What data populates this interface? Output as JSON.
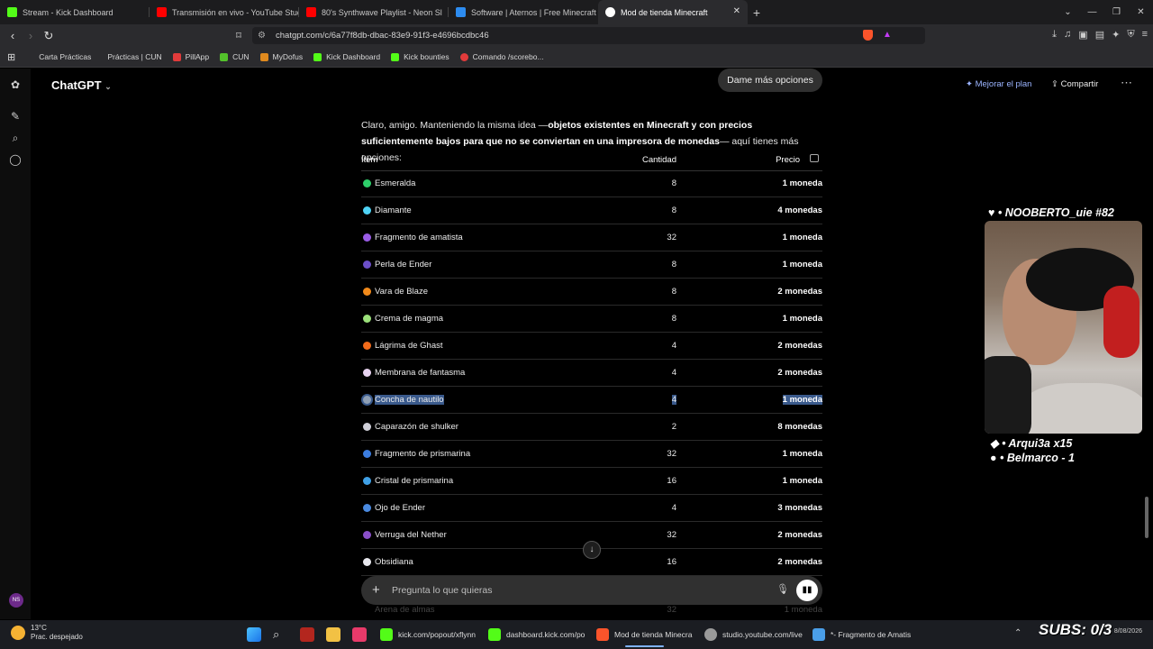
{
  "browser": {
    "tabs": [
      {
        "label": "Stream - Kick Dashboard",
        "color": "#53fc18"
      },
      {
        "label": "Transmisión en vivo - YouTube Studio",
        "color": "#ff0000"
      },
      {
        "label": "80's Synthwave Playlist - Neon Sl",
        "color": "#ff0000"
      },
      {
        "label": "Software | Aternos | Free Minecraft S",
        "color": "#2d8cf0"
      },
      {
        "label": "Mod de tienda Minecraft",
        "color": "#ffffff"
      }
    ],
    "new_tab": "+",
    "url": "chatgpt.com/c/6a77f8db-dbac-83e9-91f3-e4696bcdbc46",
    "bookmarks": [
      {
        "label": "Carta Prácticas",
        "color": "#777777"
      },
      {
        "label": "Prácticas | CUN",
        "color": "#777777"
      },
      {
        "label": "PillApp",
        "color": "#e23b3b"
      },
      {
        "label": "CUN",
        "color": "#53c22b"
      },
      {
        "label": "MyDofus",
        "color": "#e08a1e"
      },
      {
        "label": "Kick Dashboard",
        "color": "#53fc18"
      },
      {
        "label": "Kick bounties",
        "color": "#53fc18"
      },
      {
        "label": "Comando /scorebo...",
        "color": "#e23b3b"
      }
    ]
  },
  "chatgpt": {
    "title": "ChatGPT",
    "pill": "Dame más opciones",
    "upgrade": "Mejorar el plan",
    "share": "Compartir",
    "intro_start": "Claro, amigo. Manteniendo la misma idea —",
    "intro_bold": "objetos existentes en Minecraft y con precios suficientemente bajos para que no se conviertan en una impresora de monedas",
    "intro_end": "— aquí tienes más opciones:",
    "table": {
      "headers": {
        "item": "Ítem",
        "qty": "Cantidad",
        "price": "Precio"
      },
      "rows": [
        {
          "name": "Esmeralda",
          "qty": "8",
          "price": "1 moneda",
          "icon": "#2ecf6a"
        },
        {
          "name": "Diamante",
          "qty": "8",
          "price": "4 monedas",
          "icon": "#4fd3f5"
        },
        {
          "name": "Fragmento de amatista",
          "qty": "32",
          "price": "1 moneda",
          "icon": "#9a5ce6"
        },
        {
          "name": "Perla de Ender",
          "qty": "8",
          "price": "1 moneda",
          "icon": "#6c4fc9"
        },
        {
          "name": "Vara de Blaze",
          "qty": "8",
          "price": "2 monedas",
          "icon": "#f28a1a"
        },
        {
          "name": "Crema de magma",
          "qty": "8",
          "price": "1 moneda",
          "icon": "#9be07a"
        },
        {
          "name": "Lágrima de Ghast",
          "qty": "4",
          "price": "2 monedas",
          "icon": "#f26b1a"
        },
        {
          "name": "Membrana de fantasma",
          "qty": "4",
          "price": "2 monedas",
          "icon": "#e8d3f0"
        },
        {
          "name": "Concha de nautilo",
          "qty": "4",
          "price": "1 moneda",
          "icon": "#8fa0b5",
          "selected": true
        },
        {
          "name": "Caparazón de shulker",
          "qty": "2",
          "price": "8 monedas",
          "icon": "#cfcfd8"
        },
        {
          "name": "Fragmento de prismarina",
          "qty": "32",
          "price": "1 moneda",
          "icon": "#3b7de0"
        },
        {
          "name": "Cristal de prismarina",
          "qty": "16",
          "price": "1 moneda",
          "icon": "#3fa0e6"
        },
        {
          "name": "Ojo de Ender",
          "qty": "4",
          "price": "3 monedas",
          "icon": "#4a8ae0"
        },
        {
          "name": "Verruga del Nether",
          "qty": "32",
          "price": "2 monedas",
          "icon": "#8a4fc9"
        },
        {
          "name": "Obsidiana",
          "qty": "16",
          "price": "2 monedas",
          "icon": "#e8e8ee"
        }
      ],
      "faded_row": {
        "name": "Arena de almas",
        "qty": "32",
        "price": "1 moneda"
      }
    },
    "composer_placeholder": "Pregunta lo que quieras"
  },
  "stream_overlay": {
    "top_donor": "♥ • NOOBERTO_uie  #82",
    "donors": [
      "◆ • Arqui3a x15",
      "● • Belmarco - 1"
    ],
    "subs": "SUBS: 0/3"
  },
  "taskbar": {
    "weather_temp": "13°C",
    "weather_desc": "Prac. despejado",
    "apps": [
      {
        "label": "kick.com/popout/xflynn",
        "color": "#53fc18"
      },
      {
        "label": "dashboard.kick.com/po",
        "color": "#53fc18"
      },
      {
        "label": "Mod de tienda Minecra",
        "color": "#fb542b"
      },
      {
        "label": "studio.youtube.com/live",
        "color": "#9a9a9a"
      },
      {
        "label": "*- Fragmento de Amatis",
        "color": "#4a9ee8"
      }
    ],
    "date": "8/08/2026"
  }
}
